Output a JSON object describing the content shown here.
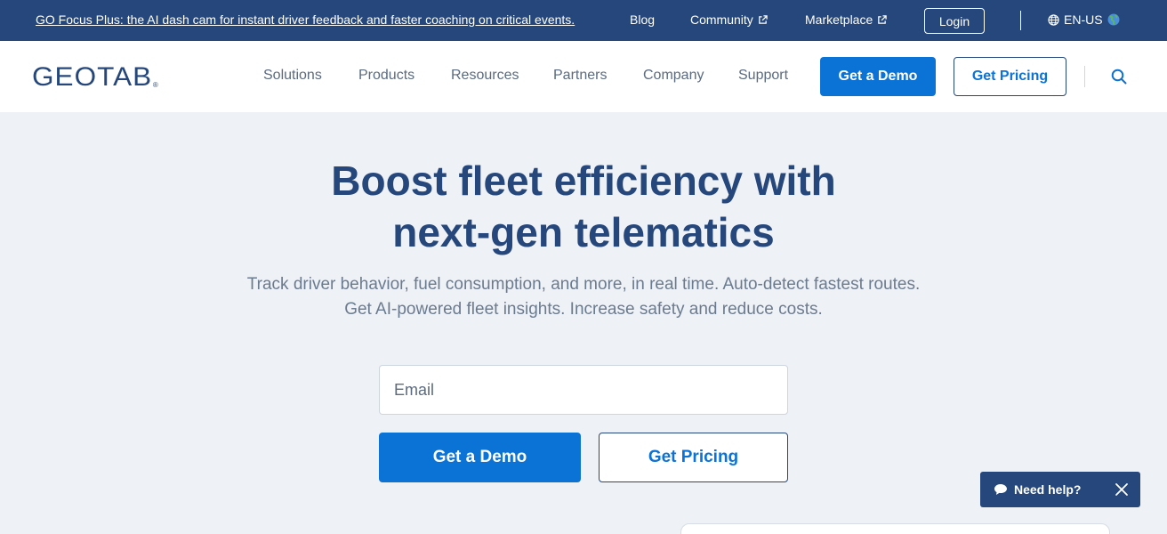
{
  "topbar": {
    "announcement": "GO Focus Plus: the AI dash cam for instant driver feedback and faster coaching on critical events.",
    "links": [
      {
        "label": "Blog",
        "external": false
      },
      {
        "label": "Community",
        "external": true
      },
      {
        "label": "Marketplace",
        "external": true
      }
    ],
    "login_label": "Login",
    "language": "EN-US"
  },
  "nav": {
    "logo_text": "GEOTAB",
    "logo_mark": "®",
    "items": [
      "Solutions",
      "Products",
      "Resources",
      "Partners",
      "Company",
      "Support"
    ],
    "demo_label": "Get a Demo",
    "pricing_label": "Get Pricing"
  },
  "hero": {
    "title_line1": "Boost fleet efficiency with",
    "title_line2": "next-gen telematics",
    "subtitle_line1": "Track driver behavior, fuel consumption, and more, in real time. Auto-detect fastest routes.",
    "subtitle_line2": "Get AI-powered fleet insights. Increase safety and reduce costs.",
    "email_placeholder": "Email",
    "email_value": "",
    "demo_label": "Get a Demo",
    "pricing_label": "Get Pricing"
  },
  "help_widget": {
    "label": "Need help?"
  },
  "colors": {
    "brand_navy": "#25477b",
    "accent_blue": "#0b72d6",
    "page_bg": "#eef1f6"
  }
}
